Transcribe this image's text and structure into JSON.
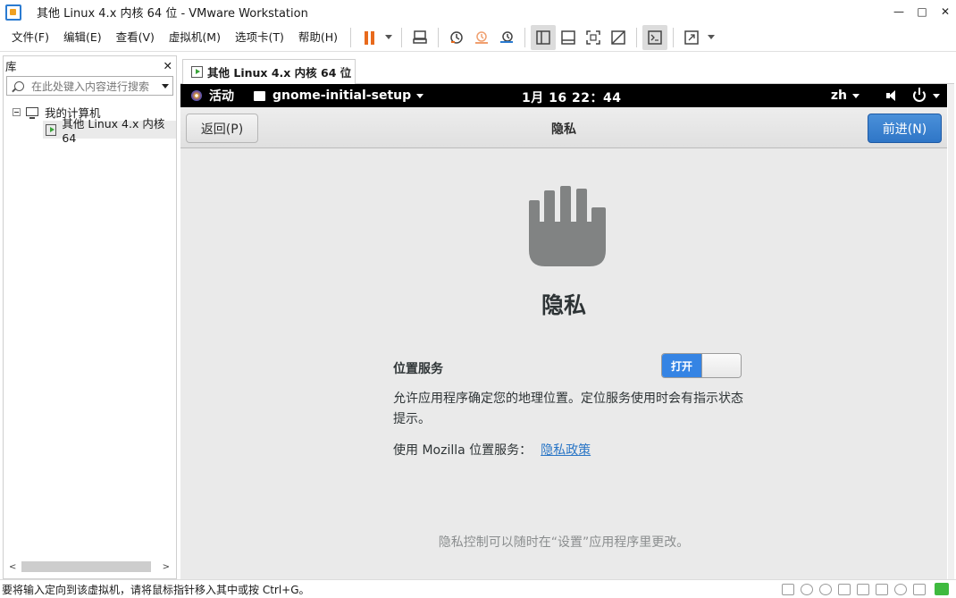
{
  "window": {
    "title": "其他 Linux 4.x 内核 64 位 - VMware Workstation",
    "controls": {
      "minimize": "—",
      "maximize": "□",
      "close": "✕"
    }
  },
  "menubar": {
    "items": [
      "文件(F)",
      "编辑(E)",
      "查看(V)",
      "虚拟机(M)",
      "选项卡(T)",
      "帮助(H)"
    ],
    "toolbar_icons": [
      "pause-icon",
      "send-ctrl-alt-del-icon",
      "snapshot-icon",
      "revert-snapshot-icon",
      "snapshot-manager-icon",
      "library-view-icon",
      "thumbnail-view-icon",
      "full-screen-icon",
      "unity-icon",
      "console-icon",
      "stretch-icon"
    ],
    "accent": "#e86a1c"
  },
  "library": {
    "title": "库",
    "close": "✕",
    "search_placeholder": "在此处键入内容进行搜索",
    "tree": {
      "root": "我的计算机",
      "vm": "其他 Linux 4.x 内核 64"
    }
  },
  "tab": {
    "label": "其他 Linux 4.x 内核 64 位",
    "close": "✕"
  },
  "gnome": {
    "activities": "活动",
    "app_menu": "gnome-initial-setup",
    "clock": "1月 16  22：44",
    "language": "zh"
  },
  "setup": {
    "back_label": "返回(P)",
    "header_title": "隐私",
    "next_label": "前进(N)",
    "heading": "隐私",
    "location_label": "位置服务",
    "toggle_label": "打开",
    "toggle_on": true,
    "location_desc": "允许应用程序确定您的地理位置。定位服务使用时会有指示状态提示。",
    "mozilla_text": "使用 Mozilla 位置服务：",
    "policy_link": "隐私政策",
    "footer": "隐私控制可以随时在“设置”应用程序里更改。",
    "accent": "#3584e4"
  },
  "statusbar": {
    "text": "要将输入定向到该虚拟机，请将鼠标指针移入其中或按 Ctrl+G。"
  }
}
